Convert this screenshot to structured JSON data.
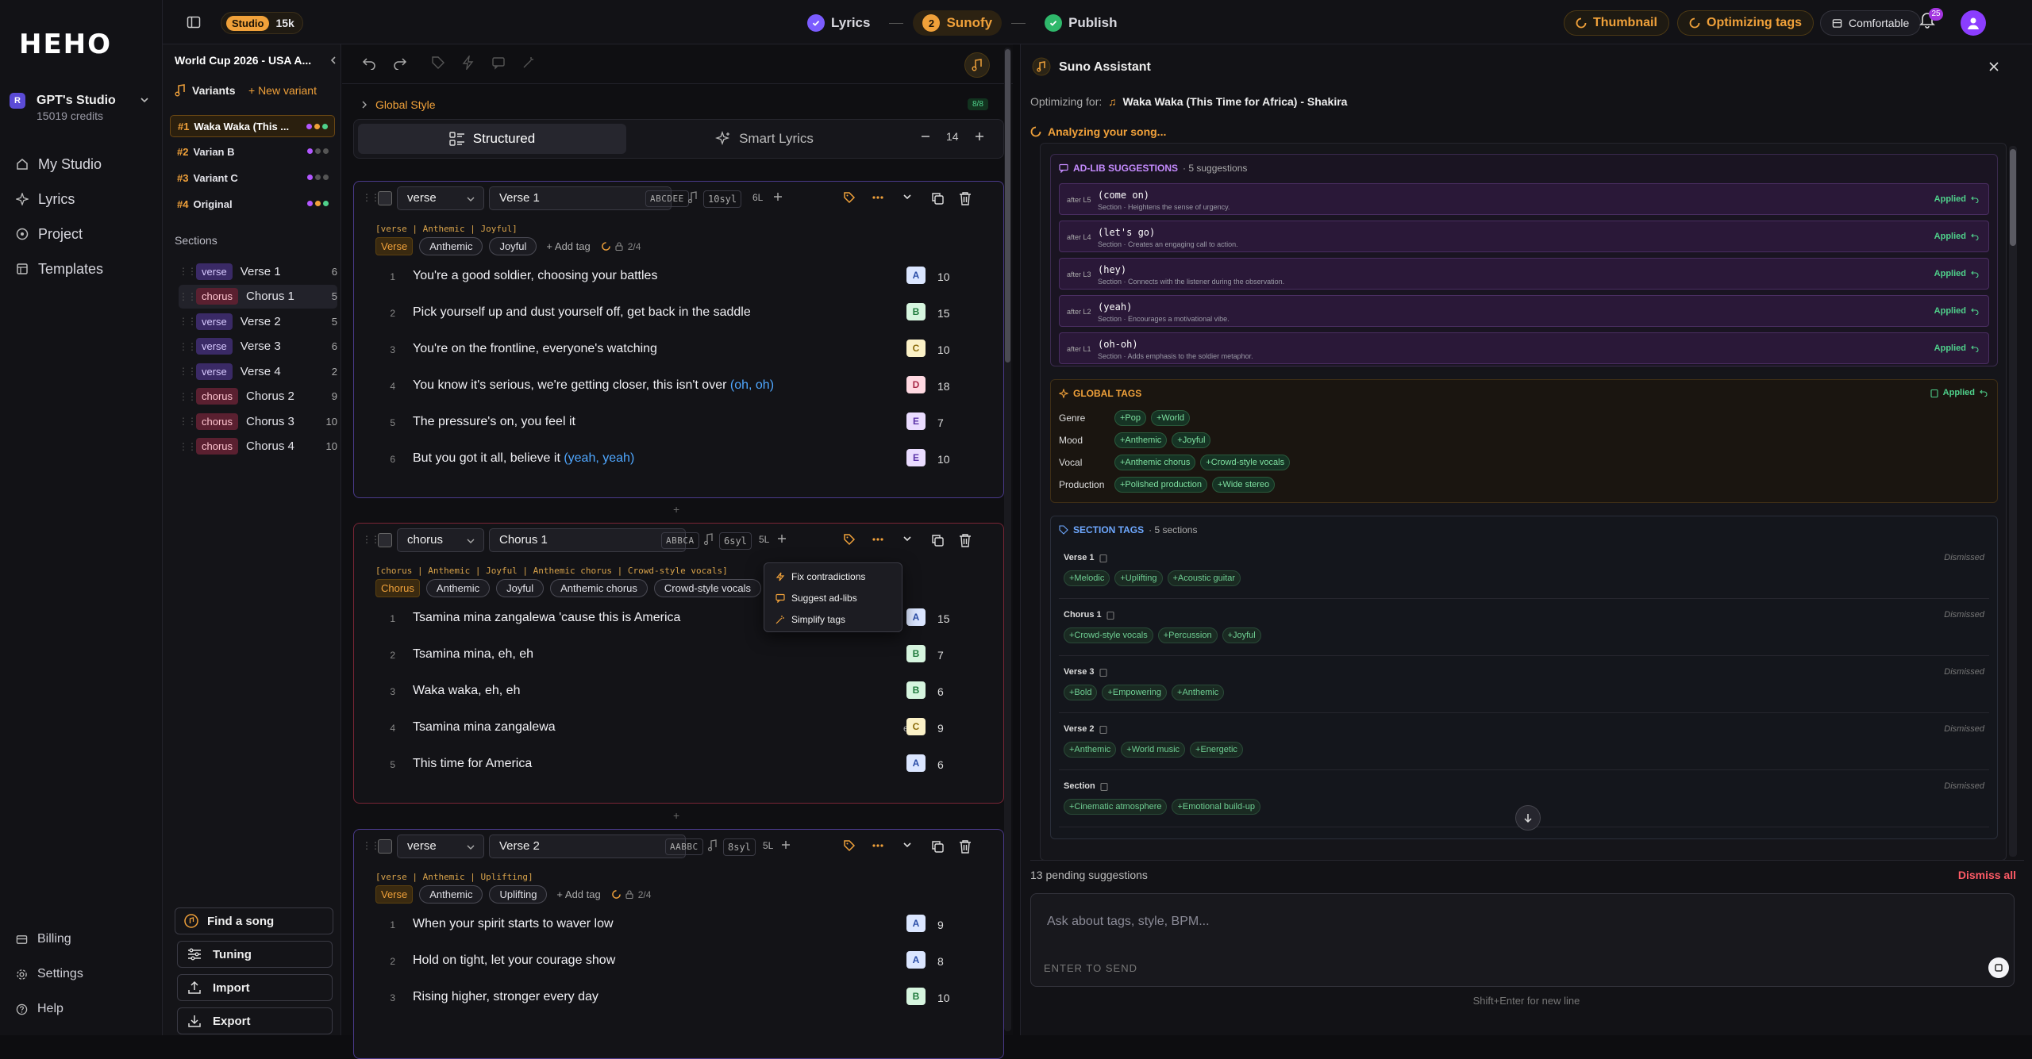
{
  "brand": {
    "logo": "HEHO"
  },
  "workspace": {
    "badge": "R",
    "name": "GPT's Studio",
    "credits": "15019 credits"
  },
  "nav": {
    "items": [
      "My Studio",
      "Lyrics",
      "Project",
      "Templates"
    ],
    "bottom": [
      "Billing",
      "Settings",
      "Help"
    ]
  },
  "topbar": {
    "plan": "Studio",
    "plan_count": "15k",
    "steps": [
      {
        "label": "Lyrics",
        "state": "done"
      },
      {
        "label": "Sunofy",
        "num": "2",
        "state": "active"
      },
      {
        "label": "Publish",
        "state": "done"
      }
    ],
    "thumbnail": "Thumbnail",
    "optimizing": "Optimizing tags",
    "density": "Comfortable",
    "notif_count": "25"
  },
  "sidebar": {
    "song_title": "World Cup 2026 - USA A...",
    "variants_label": "Variants",
    "new_variant": "+ New variant",
    "variants": [
      {
        "num": "#1",
        "name": "Waka Waka (This ...",
        "dots": [
          "#b257ff",
          "#f0a13a",
          "#4fd18b"
        ]
      },
      {
        "num": "#2",
        "name": "Varian B",
        "dots": [
          "#b257ff",
          "#555",
          "#555"
        ]
      },
      {
        "num": "#3",
        "name": "Variant C",
        "dots": [
          "#b257ff",
          "#555",
          "#555"
        ]
      },
      {
        "num": "#4",
        "name": "Original",
        "dots": [
          "#b257ff",
          "#f0a13a",
          "#4fd18b"
        ]
      }
    ],
    "sections_label": "Sections",
    "sections": [
      {
        "type": "verse",
        "name": "Verse 1",
        "count": "6"
      },
      {
        "type": "chorus",
        "name": "Chorus 1",
        "count": "5"
      },
      {
        "type": "verse",
        "name": "Verse 2",
        "count": "5"
      },
      {
        "type": "verse",
        "name": "Verse 3",
        "count": "6"
      },
      {
        "type": "verse",
        "name": "Verse 4",
        "count": "2"
      },
      {
        "type": "chorus",
        "name": "Chorus 2",
        "count": "9"
      },
      {
        "type": "chorus",
        "name": "Chorus 3",
        "count": "10"
      },
      {
        "type": "chorus",
        "name": "Chorus 4",
        "count": "10"
      }
    ],
    "find_song": "Find a song",
    "tuning": "Tuning",
    "import": "Import",
    "export": "Export"
  },
  "editor": {
    "global_style": "Global Style",
    "global_badge": "8/8",
    "mode_structured": "Structured",
    "mode_smart": "Smart Lyrics",
    "font_size": "14",
    "add_tag": "+ Add tag",
    "cards": [
      {
        "type": "verse",
        "name": "Verse 1",
        "rhyme": "ABCDEE",
        "syl": "10syl",
        "lines_count": "6L",
        "tagline": "[verse | Anthemic | Joyful]",
        "tags": [
          "Verse",
          "Anthemic",
          "Joyful"
        ],
        "progress": "2/4",
        "lines": [
          {
            "text": "You're a good soldier, choosing your battles",
            "adlib": "",
            "end": "les",
            "rhyme": "A",
            "syl": "10"
          },
          {
            "text": "Pick yourself up and dust yourself off, get back in the saddle",
            "adlib": "",
            "end": "dle",
            "rhyme": "B",
            "syl": "15"
          },
          {
            "text": "You're on the frontline, everyone's watching",
            "adlib": "",
            "end": "ing",
            "rhyme": "C",
            "syl": "10"
          },
          {
            "text": "You know it's serious, we're getting closer, this isn't over ",
            "adlib": "(oh, oh)",
            "end": "er",
            "rhyme": "D",
            "syl": "18"
          },
          {
            "text": "The pressure's on, you feel it",
            "adlib": "",
            "end": "it",
            "rhyme": "E",
            "syl": "7"
          },
          {
            "text": "But you got it all, believe it ",
            "adlib": "(yeah, yeah)",
            "end": "it",
            "rhyme": "E",
            "syl": "10"
          }
        ]
      },
      {
        "type": "chorus",
        "name": "Chorus 1",
        "rhyme": "ABBCA",
        "syl": "6syl",
        "lines_count": "5L",
        "tagline": "[chorus | Anthemic | Joyful | Anthemic chorus | Crowd-style vocals]",
        "tags": [
          "Chorus",
          "Anthemic",
          "Joyful",
          "Anthemic chorus",
          "Crowd-style vocals"
        ],
        "lines": [
          {
            "text": "Tsamina mina zangalewa 'cause this is America",
            "adlib": "",
            "end": "ica",
            "rhyme": "A",
            "syl": "15"
          },
          {
            "text": "Tsamina mina, eh, eh",
            "adlib": "",
            "end": "eh",
            "rhyme": "B",
            "syl": "7"
          },
          {
            "text": "Waka waka, eh, eh",
            "adlib": "",
            "end": "eh",
            "rhyme": "B",
            "syl": "6"
          },
          {
            "text": "Tsamina mina zangalewa",
            "adlib": "",
            "end": "ewa",
            "rhyme": "C",
            "syl": "9"
          },
          {
            "text": "This time for America",
            "adlib": "",
            "end": "ica",
            "rhyme": "A",
            "syl": "6"
          }
        ]
      },
      {
        "type": "verse",
        "name": "Verse 2",
        "rhyme": "AABBC",
        "syl": "8syl",
        "lines_count": "5L",
        "tagline": "[verse | Anthemic | Uplifting]",
        "tags": [
          "Verse",
          "Anthemic",
          "Uplifting"
        ],
        "progress": "2/4",
        "lines": [
          {
            "text": "When your spirit starts to waver low",
            "adlib": "",
            "end": "ow",
            "rhyme": "A",
            "syl": "9"
          },
          {
            "text": "Hold on tight, let your courage show",
            "adlib": "",
            "end": "ow",
            "rhyme": "A",
            "syl": "8"
          },
          {
            "text": "Rising higher, stronger every day",
            "adlib": "",
            "end": "ay",
            "rhyme": "B",
            "syl": "10"
          }
        ]
      }
    ],
    "menu": [
      "Fix contradictions",
      "Suggest ad-libs",
      "Simplify tags"
    ]
  },
  "assistant": {
    "title": "Suno Assistant",
    "optimizing_label": "Optimizing for:",
    "optimizing_song": "Waka Waka (This Time for Africa) - Shakira",
    "analyzing": "Analyzing your song...",
    "adlib_title": "AD-LIB SUGGESTIONS",
    "adlib_sub": "· 5 suggestions",
    "applied": "Applied",
    "adlibs": [
      {
        "where": "after L5",
        "text": "(come on)",
        "desc": "Section · Heightens the sense of urgency."
      },
      {
        "where": "after L4",
        "text": "(let's go)",
        "desc": "Section · Creates an engaging call to action."
      },
      {
        "where": "after L3",
        "text": "(hey)",
        "desc": "Section · Connects with the listener during the observation."
      },
      {
        "where": "after L2",
        "text": "(yeah)",
        "desc": "Section · Encourages a motivational vibe."
      },
      {
        "where": "after L1",
        "text": "(oh-oh)",
        "desc": "Section · Adds emphasis to the soldier metaphor."
      }
    ],
    "global_title": "GLOBAL TAGS",
    "global_rows": [
      {
        "label": "Genre",
        "tags": [
          "+Pop",
          "+World"
        ]
      },
      {
        "label": "Mood",
        "tags": [
          "+Anthemic",
          "+Joyful"
        ]
      },
      {
        "label": "Vocal",
        "tags": [
          "+Anthemic chorus",
          "+Crowd-style vocals"
        ]
      },
      {
        "label": "Production",
        "tags": [
          "+Polished production",
          "+Wide stereo"
        ]
      }
    ],
    "section_title": "SECTION TAGS",
    "section_sub": "· 5 sections",
    "dismissed": "Dismissed",
    "section_rows": [
      {
        "name": "Verse 1",
        "tags": [
          "+Melodic",
          "+Uplifting",
          "+Acoustic guitar"
        ]
      },
      {
        "name": "Chorus 1",
        "tags": [
          "+Crowd-style vocals",
          "+Percussion",
          "+Joyful"
        ]
      },
      {
        "name": "Verse 3",
        "tags": [
          "+Bold",
          "+Empowering",
          "+Anthemic"
        ]
      },
      {
        "name": "Verse 2",
        "tags": [
          "+Anthemic",
          "+World music",
          "+Energetic"
        ]
      },
      {
        "name": "Section",
        "tags": [
          "+Cinematic atmosphere",
          "+Emotional build-up"
        ]
      }
    ],
    "pending": "13 pending suggestions",
    "dismiss_all": "Dismiss all",
    "chat_placeholder": "Ask about tags, style, BPM...",
    "enter_to_send": "ENTER TO SEND",
    "hint": "Shift+Enter for new line"
  }
}
